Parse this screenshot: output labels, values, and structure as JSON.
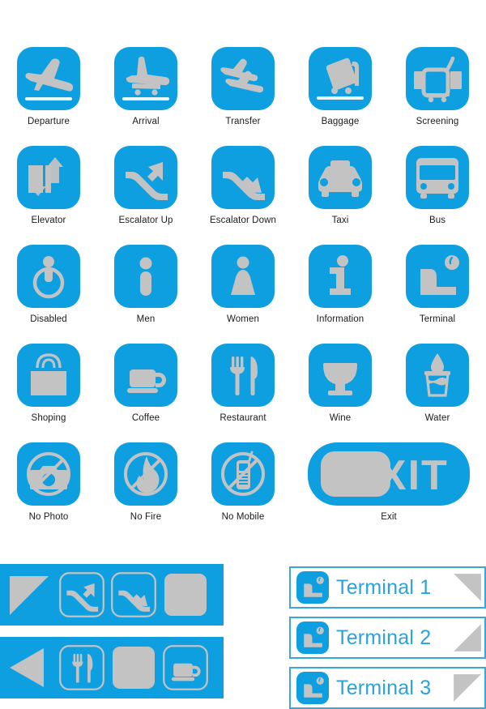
{
  "palette": {
    "blue": "#0D9FE0",
    "blue_line": "#3AA6DC",
    "blue_text": "#29A3DC",
    "gray": "#C3C3C3",
    "label": "#1b1b1b",
    "background": "#ffffff"
  },
  "icon_grid": {
    "rows": [
      [
        {
          "label": "Departure",
          "icon": "departure-plane-icon"
        },
        {
          "label": "Arrival",
          "icon": "arrival-plane-icon"
        },
        {
          "label": "Transfer",
          "icon": "transfer-planes-icon"
        },
        {
          "label": "Baggage",
          "icon": "baggage-trolley-icon"
        },
        {
          "label": "Screening",
          "icon": "security-screening-icon"
        }
      ],
      [
        {
          "label": "Elevator",
          "icon": "elevator-icon"
        },
        {
          "label": "Escalator Up",
          "icon": "escalator-up-icon"
        },
        {
          "label": "Escalator Down",
          "icon": "escalator-down-icon"
        },
        {
          "label": "Taxi",
          "icon": "taxi-icon"
        },
        {
          "label": "Bus",
          "icon": "bus-icon"
        }
      ],
      [
        {
          "label": "Disabled",
          "icon": "wheelchair-icon"
        },
        {
          "label": "Men",
          "icon": "men-restroom-icon"
        },
        {
          "label": "Women",
          "icon": "women-restroom-icon"
        },
        {
          "label": "Information",
          "icon": "information-icon"
        },
        {
          "label": "Terminal",
          "icon": "terminal-building-icon"
        }
      ],
      [
        {
          "label": "Shoping",
          "icon": "shopping-bag-icon"
        },
        {
          "label": "Coffee",
          "icon": "coffee-cup-icon"
        },
        {
          "label": "Restaurant",
          "icon": "fork-knife-icon"
        },
        {
          "label": "Wine",
          "icon": "wine-glass-icon"
        },
        {
          "label": "Water",
          "icon": "drinking-water-icon"
        }
      ],
      [
        {
          "label": "No Photo",
          "icon": "no-photo-icon"
        },
        {
          "label": "No Fire",
          "icon": "no-fire-icon"
        },
        {
          "label": "No Mobile",
          "icon": "no-mobile-icon"
        },
        {
          "label": "Exit",
          "icon": "exit-sign-icon",
          "wide": true,
          "text": "EXIT"
        }
      ]
    ]
  },
  "banners": [
    {
      "name": "wayfinding-banner-escalators",
      "items": [
        {
          "icon": "triangle-arrow-up-left-icon"
        },
        {
          "icon": "escalator-up-icon"
        },
        {
          "icon": "escalator-down-icon"
        },
        {
          "icon": "blank-plate-icon"
        }
      ]
    },
    {
      "name": "wayfinding-banner-dining",
      "items": [
        {
          "icon": "triangle-arrow-left-icon"
        },
        {
          "icon": "fork-knife-icon"
        },
        {
          "icon": "blank-plate-icon"
        },
        {
          "icon": "coffee-cup-icon"
        }
      ]
    }
  ],
  "terminal_cards": [
    {
      "label": "Terminal 1",
      "icon": "terminal-building-icon",
      "arrow": "triangle-arrow-right-down-icon"
    },
    {
      "label": "Terminal 2",
      "icon": "terminal-building-icon",
      "arrow": "triangle-arrow-left-down-icon"
    },
    {
      "label": "Terminal 3",
      "icon": "terminal-building-icon",
      "arrow": "triangle-arrow-down-left-icon"
    }
  ]
}
